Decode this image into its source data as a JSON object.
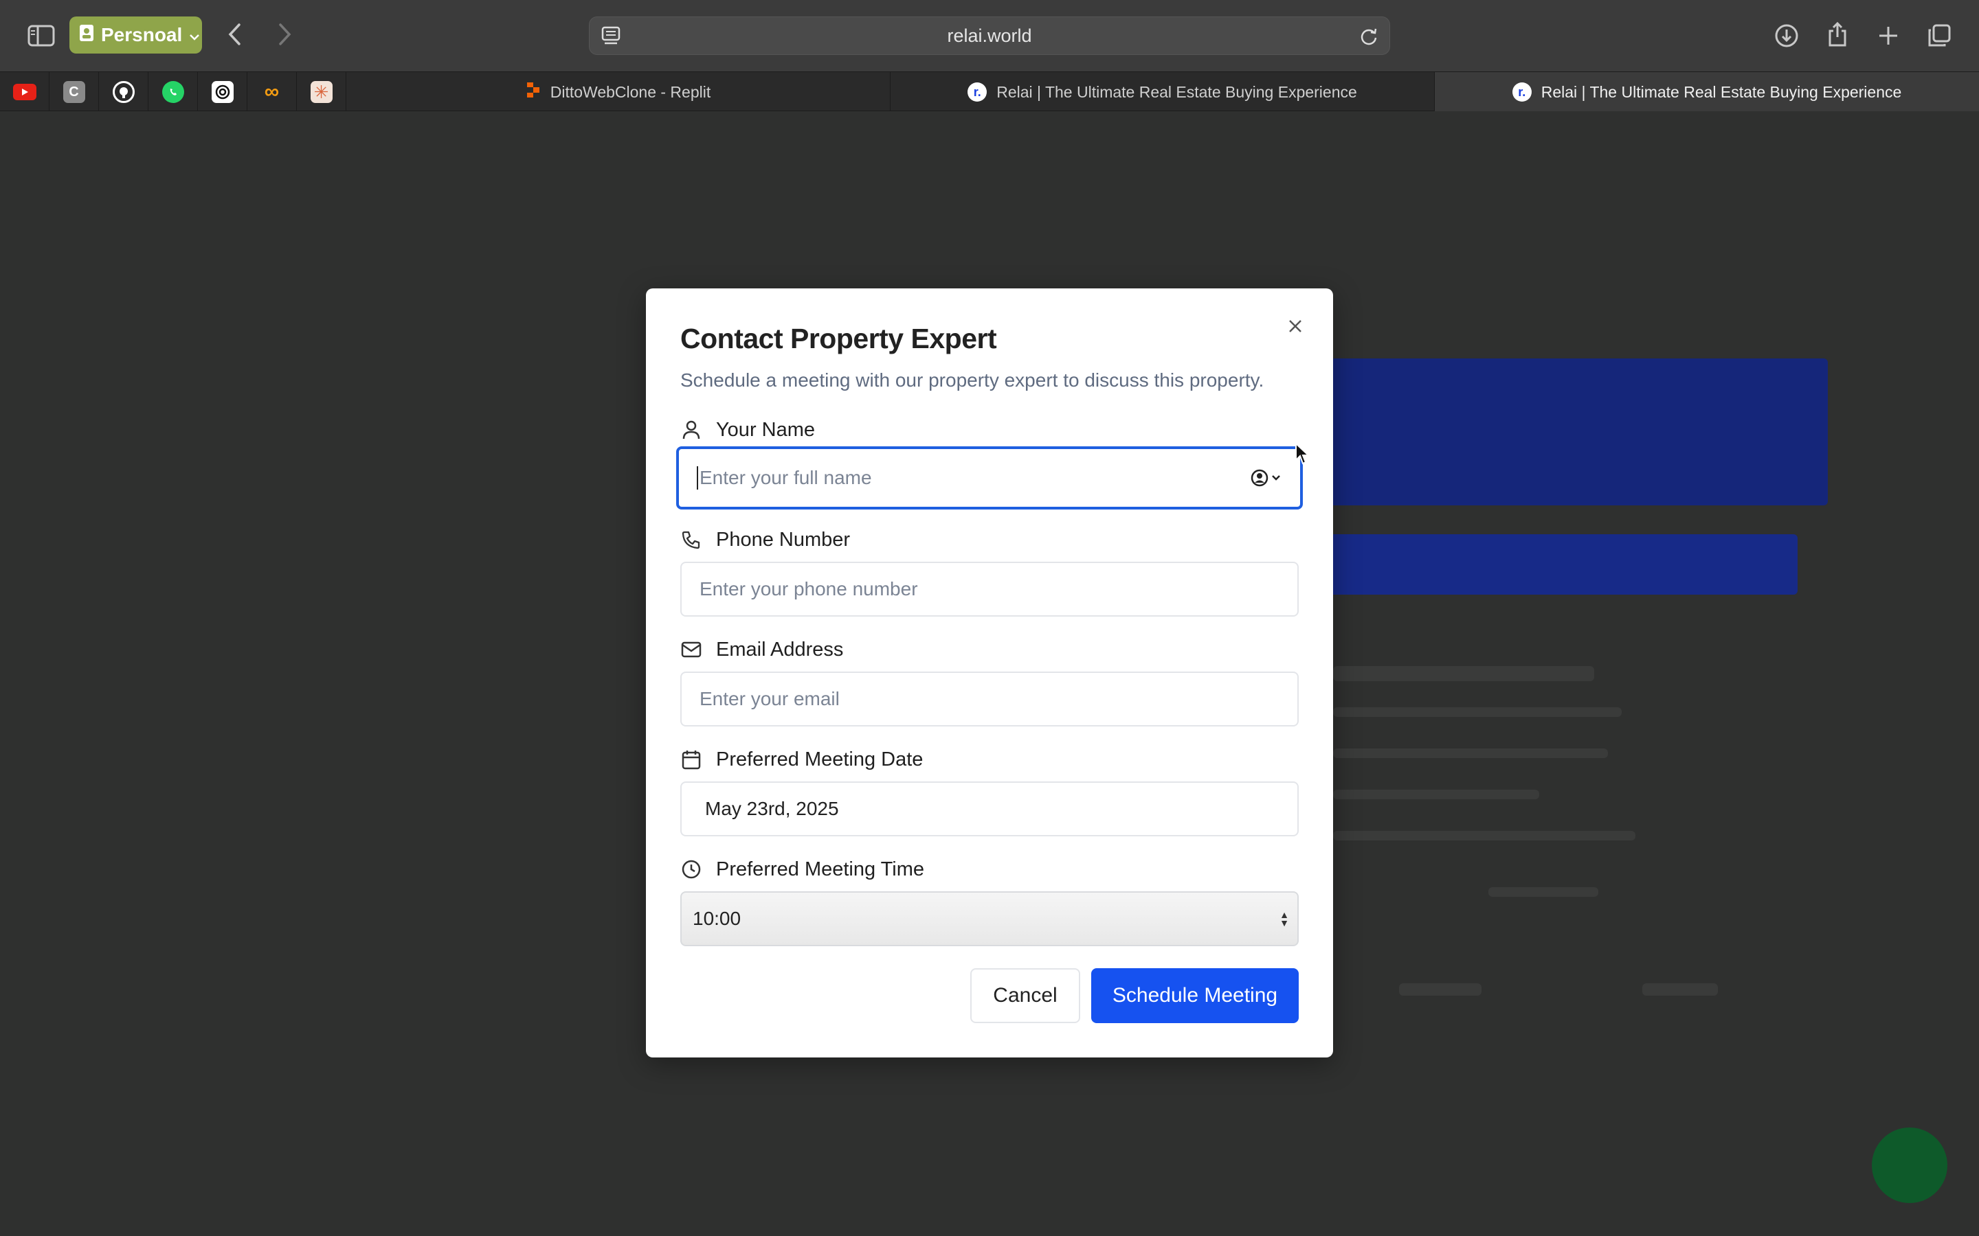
{
  "browser": {
    "profile_label": "Persnoal",
    "address": "relai.world",
    "tabs": [
      {
        "title": "DittoWebClone - Replit"
      },
      {
        "title": "Relai | The Ultimate Real Estate Buying Experience"
      },
      {
        "title": "Relai | The Ultimate Real Estate Buying Experience"
      }
    ],
    "pinned_tabs": [
      "youtube-icon",
      "c-app-icon",
      "github-icon",
      "whatsapp-icon",
      "openai-icon",
      "infinity-icon",
      "claude-icon"
    ]
  },
  "modal": {
    "title": "Contact Property Expert",
    "subtitle": "Schedule a meeting with our property expert to discuss this property.",
    "name": {
      "label": "Your Name",
      "placeholder": "Enter your full name",
      "value": ""
    },
    "phone": {
      "label": "Phone Number",
      "placeholder": "Enter your phone number",
      "value": ""
    },
    "email": {
      "label": "Email Address",
      "placeholder": "Enter your email",
      "value": ""
    },
    "date": {
      "label": "Preferred Meeting Date",
      "value": "May 23rd, 2025"
    },
    "time": {
      "label": "Preferred Meeting Time",
      "value": "10:00"
    },
    "cancel_label": "Cancel",
    "submit_label": "Schedule Meeting"
  },
  "colors": {
    "accent": "#1652f0",
    "focus_ring": "#1f5fe0",
    "profile_pill": "#8fa54a"
  }
}
